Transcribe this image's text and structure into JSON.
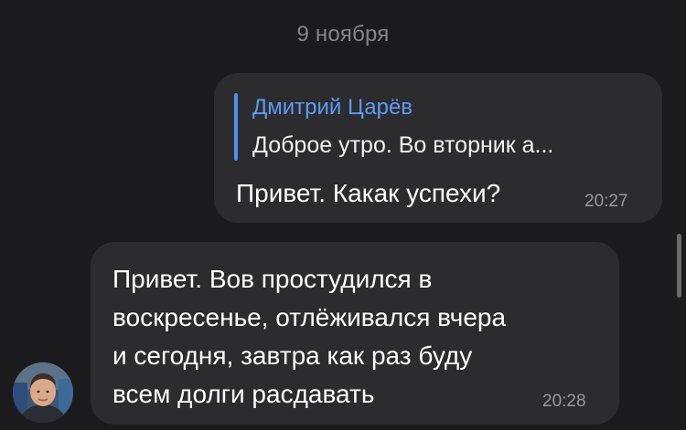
{
  "chat": {
    "date_separator": "9 ноября",
    "messages": [
      {
        "direction": "outgoing",
        "reply": {
          "author": "Дмитрий Царёв",
          "preview": "Доброе утро. Во вторник а..."
        },
        "text": "Привет. Какак успехи?",
        "time": "20:27"
      },
      {
        "direction": "incoming",
        "lines": [
          "Привет. Вов простудился в",
          "воскресенье, отлёживался вчера",
          "и сегодня, завтра как раз буду",
          "всем долги расдавать"
        ],
        "time": "20:28",
        "avatar_icon": "user-avatar"
      }
    ]
  },
  "colors": {
    "background": "#1b1b1d",
    "bubble": "#2c2c2e",
    "accent": "#5d9bf5",
    "secondary_text": "#98989d"
  }
}
